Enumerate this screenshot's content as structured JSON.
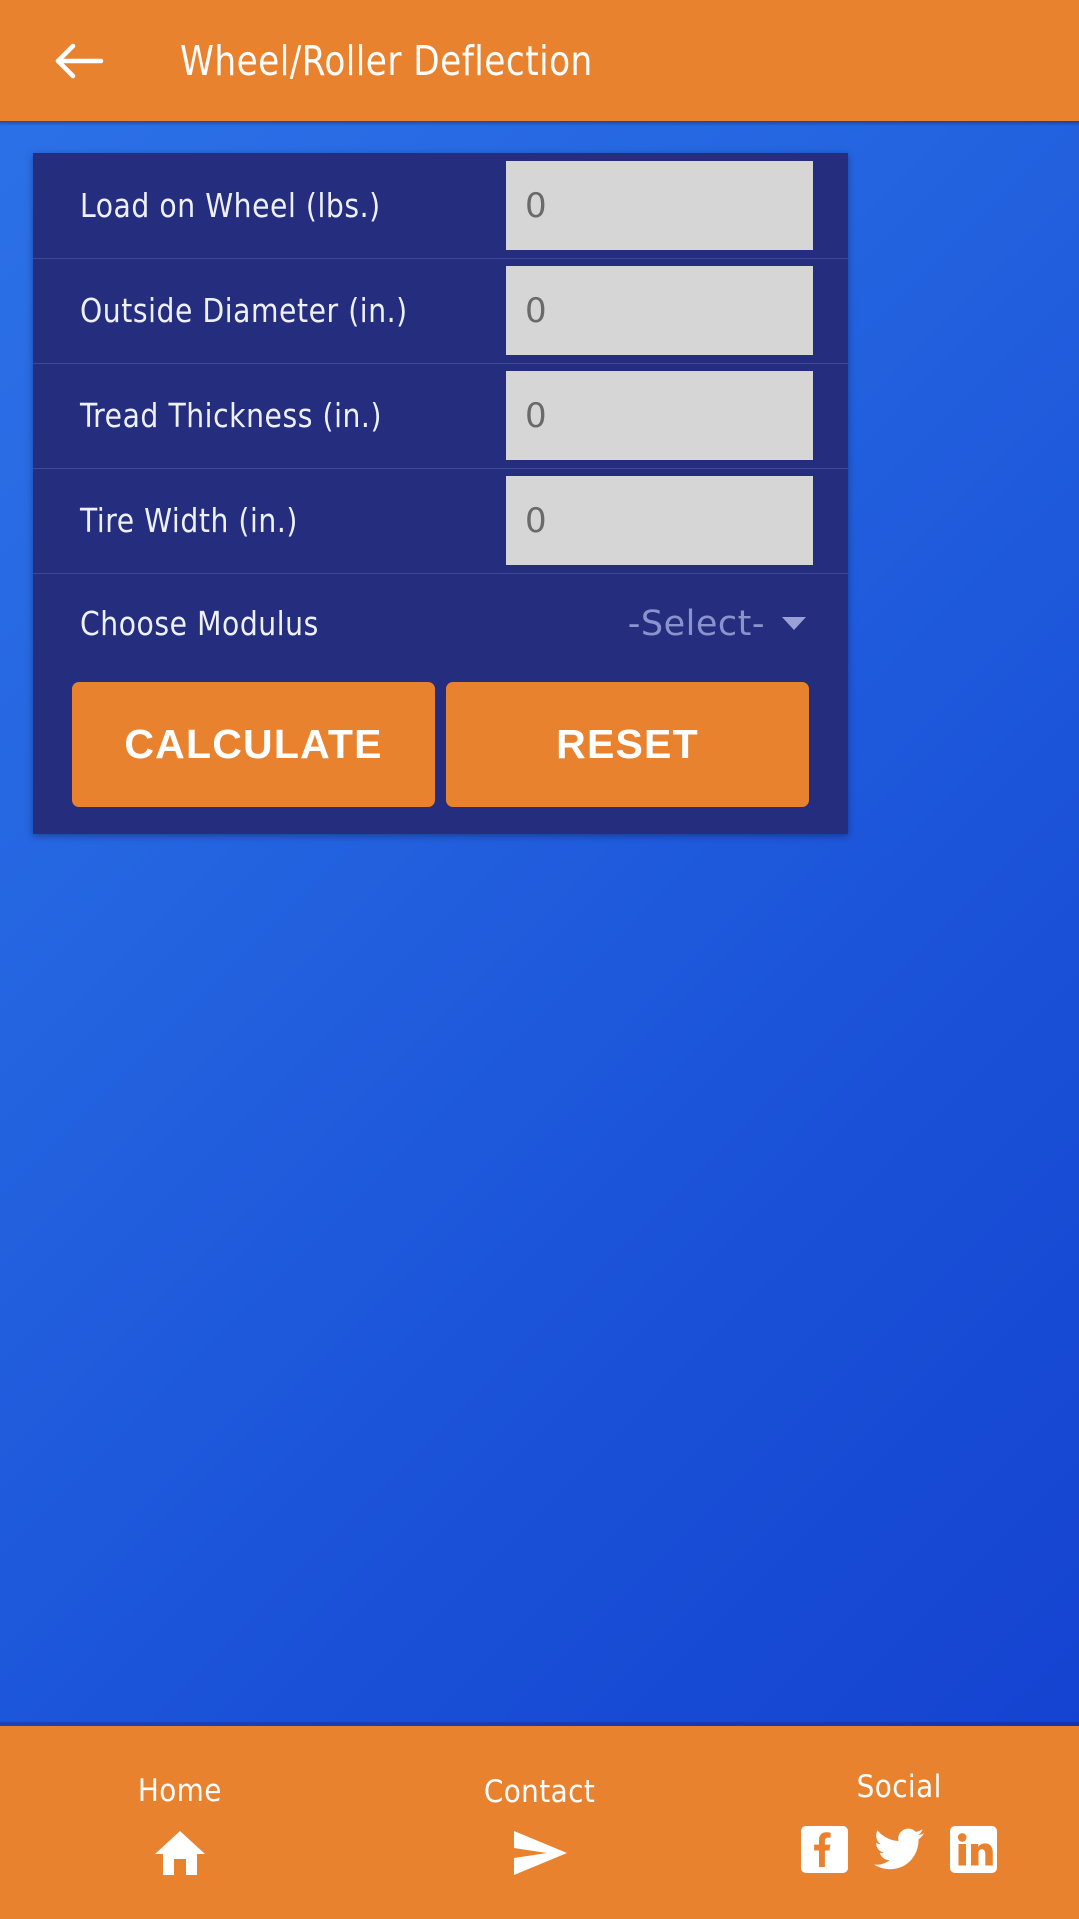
{
  "app": {
    "title": "Wheel/Roller Deflection",
    "back_icon": "arrow-left-icon"
  },
  "colors": {
    "accent_orange": "#e9822f",
    "card_navy": "#252e7e",
    "background_blue_start": "#2d72e8",
    "background_blue_end": "#1340cf",
    "field_gray": "#d6d6d6",
    "select_placeholder": "#8b93cc"
  },
  "form": {
    "fields": [
      {
        "label": "Load on Wheel (lbs.)",
        "value": "",
        "placeholder": "0",
        "name": "load-on-wheel"
      },
      {
        "label": "Outside Diameter (in.)",
        "value": "",
        "placeholder": "0",
        "name": "outside-diameter"
      },
      {
        "label": "Tread Thickness (in.)",
        "value": "",
        "placeholder": "0",
        "name": "tread-thickness"
      },
      {
        "label": "Tire Width (in.)",
        "value": "",
        "placeholder": "0",
        "name": "tire-width"
      }
    ],
    "modulus": {
      "label": "Choose Modulus",
      "selected": "-Select-",
      "caret_icon": "chevron-down-icon"
    },
    "buttons": {
      "calculate": "CALCULATE",
      "reset": "RESET"
    }
  },
  "bottom_nav": {
    "home": {
      "label": "Home",
      "icon": "home-icon"
    },
    "contact": {
      "label": "Contact",
      "icon": "send-icon"
    },
    "social": {
      "label": "Social",
      "icons": [
        {
          "name": "facebook-icon",
          "glyph": "f"
        },
        {
          "name": "twitter-icon",
          "glyph": "bird"
        },
        {
          "name": "linkedin-icon",
          "glyph": "in"
        }
      ]
    }
  }
}
